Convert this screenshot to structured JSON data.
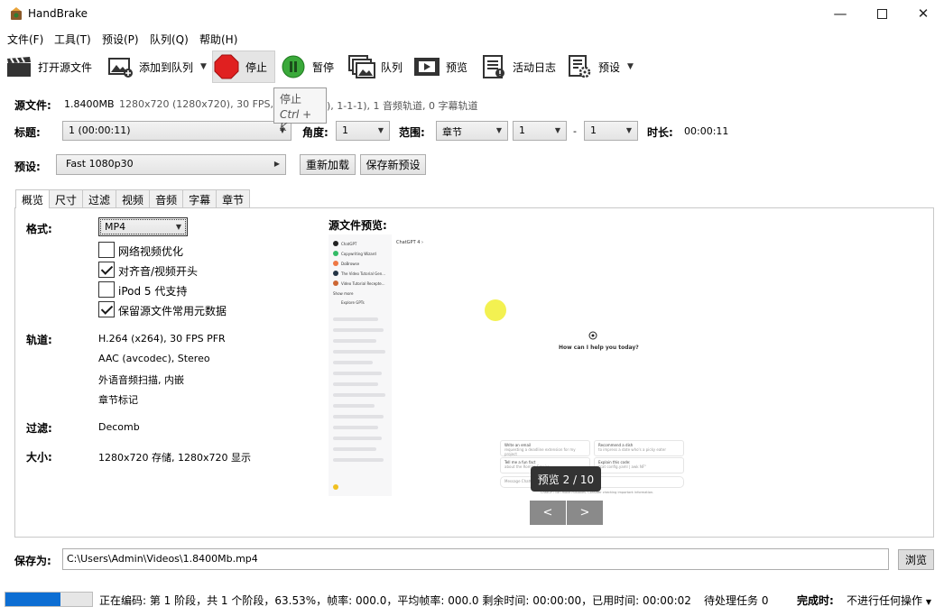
{
  "window": {
    "title": "HandBrake",
    "minimize_icon": "minimize-icon",
    "maximize_icon": "maximize-icon",
    "close_icon": "close-icon"
  },
  "menu": [
    "文件(F)",
    "工具(T)",
    "预设(P)",
    "队列(Q)",
    "帮助(H)"
  ],
  "toolbar": {
    "open_source": "打开源文件",
    "add_to_queue": "添加到队列",
    "stop": "停止",
    "pause": "暂停",
    "queue": "队列",
    "preview": "预览",
    "activity_log": "活动日志",
    "presets": "预设"
  },
  "tooltip": {
    "title": "停止",
    "shortcut": "Ctrl + K"
  },
  "source": {
    "label": "源文件:",
    "name": "1.8400MB",
    "info": "1280x720 (1280x720), 30 FPS, SDR",
    "info_tail": "), 1-1-1), 1 音频轨道, 0 字幕轨道"
  },
  "title_row": {
    "title_label": "标题:",
    "title_value": "1  (00:00:11)",
    "angle_label": "角度:",
    "angle_value": "1",
    "range_label": "范围:",
    "range_type": "章节",
    "range_from": "1",
    "range_dash": "-",
    "range_to": "1",
    "duration_label": "时长:",
    "duration_value": "00:00:11"
  },
  "preset_row": {
    "label": "预设:",
    "value": "Fast 1080p30",
    "reload": "重新加载",
    "save_new": "保存新预设"
  },
  "tabs": [
    "概览",
    "尺寸",
    "过滤",
    "视频",
    "音频",
    "字幕",
    "章节"
  ],
  "summary": {
    "format_label": "格式:",
    "format_value": "MP4",
    "options": [
      {
        "label": "网络视频优化",
        "checked": false
      },
      {
        "label": "对齐音/视频开头",
        "checked": true
      },
      {
        "label": "iPod 5 代支持",
        "checked": false
      },
      {
        "label": "保留源文件常用元数据",
        "checked": true
      }
    ],
    "tracks_label": "轨道:",
    "tracks": [
      "H.264 (x264), 30 FPS PFR",
      "AAC (avcodec), Stereo",
      "外语音频扫描, 内嵌",
      "章节标记"
    ],
    "filters_label": "过滤:",
    "filters_value": "Decomb",
    "size_label": "大小:",
    "size_value": "1280x720 存储, 1280x720 显示"
  },
  "preview": {
    "label": "源文件预览:",
    "counter": "预览 2 / 10",
    "prev": "<",
    "next": ">",
    "screen": {
      "header": "ChatGPT 4 ›",
      "sidebar": [
        "ChatGPT",
        "Copywriting Wizard",
        "DoBrowse",
        "The Video Tutorial Gen...",
        "Video Tutorial Recepte...",
        "Show more",
        "Explore GPTs"
      ],
      "prompt": "How can I help you today?",
      "cards": [
        {
          "title": "Write an email",
          "sub": "requesting a deadline extension for my project"
        },
        {
          "title": "Recommend a dish",
          "sub": "to impress a date who's a picky eater"
        },
        {
          "title": "Tell me a fun fact",
          "sub": "about the Roman Empire"
        },
        {
          "title": "Explain this code:",
          "sub": "\"cat config.yaml | awk NF\""
        }
      ],
      "input_placeholder": "Message ChatGPT...",
      "footer": "ChatGPT can make mistakes. Consider checking important information."
    }
  },
  "save": {
    "label": "保存为:",
    "path": "C:\\Users\\Admin\\Videos\\1.8400Mb.mp4",
    "browse": "浏览"
  },
  "status": {
    "progress": 0.6353,
    "text": "正在编码: 第 1 阶段，共 1 个阶段，63.53%，帧率: 000.0，平均帧率: 000.0 剩余时间: 00:00:00，已用时间: 00:00:02",
    "pending": "待处理任务 0",
    "when_done_label": "完成时:",
    "when_done_value": "不进行任何操作"
  },
  "colors": {
    "accent": "#0d6ed3",
    "stop_red": "#e02020",
    "pause_green": "#3aa93a"
  }
}
